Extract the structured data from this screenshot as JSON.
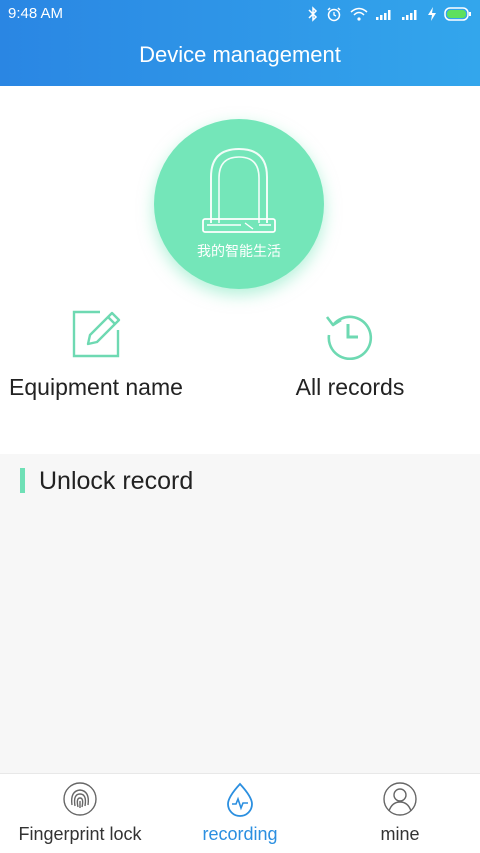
{
  "status_bar": {
    "time": "9:48 AM",
    "icons": [
      "bluetooth-icon",
      "alarm-icon",
      "wifi-icon",
      "signal-icon",
      "signal-icon",
      "charging-icon",
      "battery-icon"
    ]
  },
  "header": {
    "title": "Device management"
  },
  "device": {
    "caption": "我的智能生活",
    "icon": "padlock-icon"
  },
  "actions": [
    {
      "label": "Equipment name",
      "icon": "edit-icon"
    },
    {
      "label": "All records",
      "icon": "history-clock-icon"
    }
  ],
  "section": {
    "title": "Unlock record"
  },
  "bottom_nav": [
    {
      "label": "Fingerprint lock",
      "icon": "fingerprint-icon"
    },
    {
      "label": "recording",
      "icon": "waterdrop-pulse-icon",
      "active": true
    },
    {
      "label": "mine",
      "icon": "user-icon"
    }
  ],
  "colors": {
    "header_start": "#2a86e3",
    "header_end": "#33a6ec",
    "accent_green": "#74e6b9",
    "active_nav": "#2b8fe0"
  }
}
